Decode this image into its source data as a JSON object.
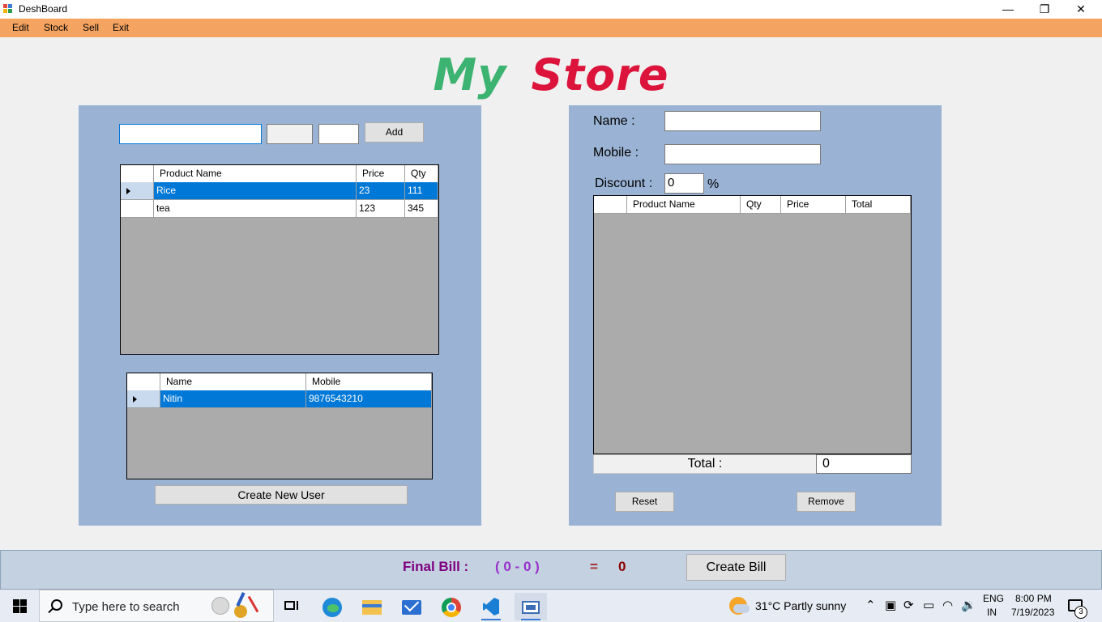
{
  "window": {
    "title": "DeshBoard",
    "minimize": "—",
    "maximize": "❐",
    "close": "✕"
  },
  "menu": [
    "Edit",
    "Stock",
    "Sell",
    "Exit"
  ],
  "store_title": {
    "word1": "My",
    "word2": "Store"
  },
  "stock": {
    "product_name_input": "",
    "price_input": "",
    "qty_input": "",
    "add_label": "Add",
    "columns": [
      "Product Name",
      "Price",
      "Qty"
    ],
    "rows": [
      {
        "name": "Rice",
        "price": "23",
        "qty": "111",
        "selected": true
      },
      {
        "name": "tea",
        "price": "123",
        "qty": "345",
        "selected": false
      }
    ]
  },
  "users": {
    "columns": [
      "Name",
      "Mobile"
    ],
    "rows": [
      {
        "name": "Nitin",
        "mobile": "9876543210",
        "selected": true
      }
    ],
    "create_label": "Create New User"
  },
  "bill": {
    "name_label": "Name :",
    "name_value": "",
    "mobile_label": "Mobile :",
    "mobile_value": "",
    "discount_label": "Discount :",
    "discount_value": "0",
    "percent": "%",
    "columns": [
      "Product Name",
      "Qty",
      "Price",
      "Total"
    ],
    "total_label": "Total :",
    "total_value": "0",
    "reset_label": "Reset",
    "remove_label": "Remove"
  },
  "footer": {
    "final_bill_label": "Final Bill :",
    "formula": "( 0 - 0 )",
    "equals": "=",
    "result": "0",
    "create_bill_label": "Create Bill",
    "colors": {
      "final_bill": "#800080",
      "formula": "#9932cc",
      "equals": "#a52a2a",
      "result": "#8b0000"
    }
  },
  "taskbar": {
    "search_placeholder": "Type here to search",
    "weather": "31°C  Partly sunny",
    "language_top": "ENG",
    "language_bottom": "IN",
    "time": "8:00 PM",
    "date": "7/19/2023",
    "notification_count": "3"
  }
}
